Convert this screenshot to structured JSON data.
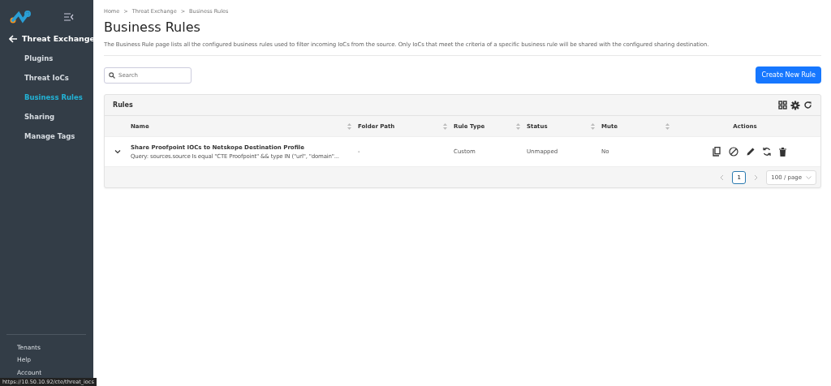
{
  "sidebar": {
    "back_label": "Threat Exchange",
    "items": [
      {
        "label": "Plugins",
        "selected": false
      },
      {
        "label": "Threat IoCs",
        "selected": false
      },
      {
        "label": "Business Rules",
        "selected": true
      },
      {
        "label": "Sharing",
        "selected": false
      },
      {
        "label": "Manage Tags",
        "selected": false
      }
    ],
    "footer_items": [
      "Tenants",
      "Help",
      "Account"
    ]
  },
  "link_preview": "https://10.50.10.92/cte/threat_iocs",
  "breadcrumb": [
    "Home",
    "Threat Exchange",
    "Business Rules"
  ],
  "breadcrumb_separator": ">",
  "title": "Business Rules",
  "description": "The Business Rule page lists all the configured business rules used to filter incoming IoCs from the source. Only IoCs that meet the criteria of a specific business rule will be shared with the configured sharing destination.",
  "search": {
    "placeholder": "Search"
  },
  "create_button": "Create New Rule",
  "table": {
    "title": "Rules",
    "columns": [
      {
        "label": "Name",
        "sortable": true
      },
      {
        "label": "Folder Path",
        "sortable": true
      },
      {
        "label": "Rule Type",
        "sortable": true
      },
      {
        "label": "Status",
        "sortable": true
      },
      {
        "label": "Mute",
        "sortable": true
      },
      {
        "label": "Actions",
        "sortable": false
      }
    ],
    "rows": [
      {
        "name": "Share Proofpoint IOCs to Netskope Destination Profile",
        "query": "Query: sources.source Is equal \"CTE Proofpoint\" && type IN (\"url\", \"domain\"...",
        "folder_path": "-",
        "rule_type": "Custom",
        "status": "Unmapped",
        "mute": "No",
        "expanded": false
      }
    ]
  },
  "pagination": {
    "pages": [
      {
        "label": "1",
        "selected": true
      }
    ],
    "page_size": "100 / page"
  }
}
